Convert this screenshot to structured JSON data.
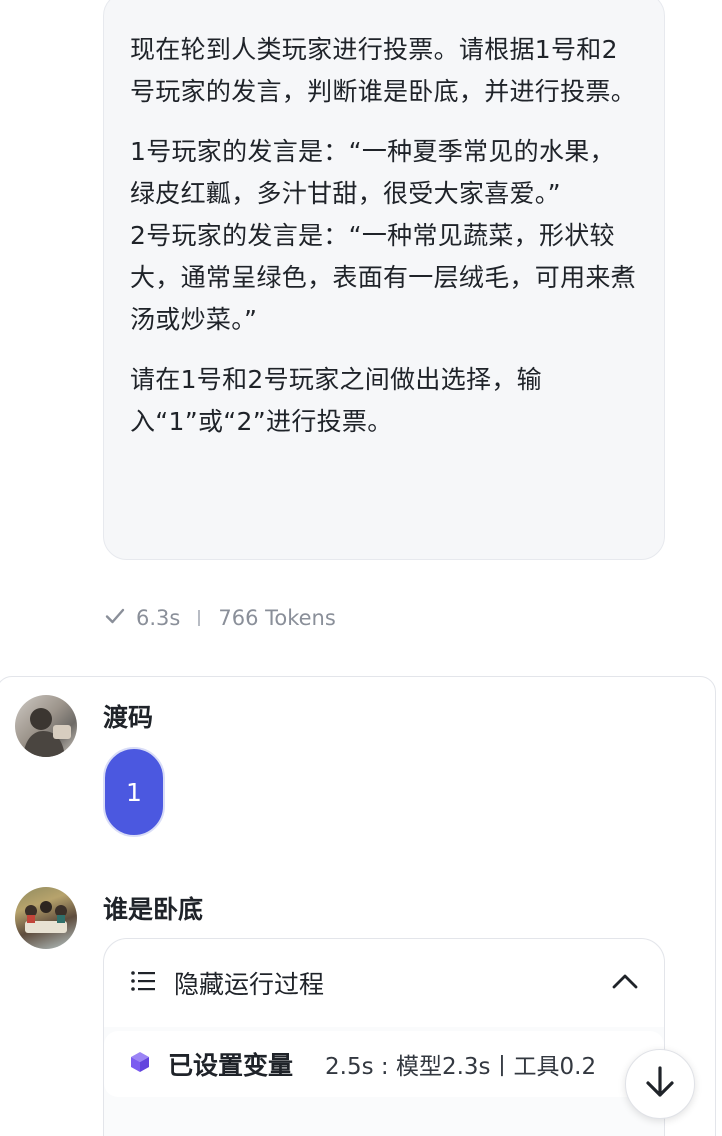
{
  "top_message": {
    "paragraphs": [
      "现在轮到人类玩家进行投票。请根据1号和2号玩家的发言，判断谁是卧底，并进行投票。",
      "1号玩家的发言是：“一种夏季常见的水果，绿皮红瓤，多汁甘甜，很受大家喜爱。”\n2号玩家的发言是：“一种常见蔬菜，形状较大，通常呈绿色，表面有一层绒毛，可用来煮汤或炒菜。”",
      "请在1号和2号玩家之间做出选择，输入“1”或“2”进行投票。"
    ],
    "duration": "6.3s",
    "tokens": "766 Tokens"
  },
  "user_message": {
    "name": "渡码",
    "text": "1"
  },
  "bot_message": {
    "name": "谁是卧底",
    "run_panel": {
      "title": "隐藏运行过程",
      "step_label": "已设置变量",
      "step_timing": "2.5s : 模型2.3s丨工具0.2"
    }
  },
  "colors": {
    "accent": "#4b58e0",
    "step_icon": "#7b5cf0",
    "bubble_bg": "#f6f7f9",
    "muted_text": "#8a8f99"
  },
  "icons": {
    "meta_status": "check-icon",
    "run_panel": "list-icon",
    "collapse": "chevron-up-icon",
    "step": "cube-icon",
    "scroll": "arrow-down-icon"
  }
}
